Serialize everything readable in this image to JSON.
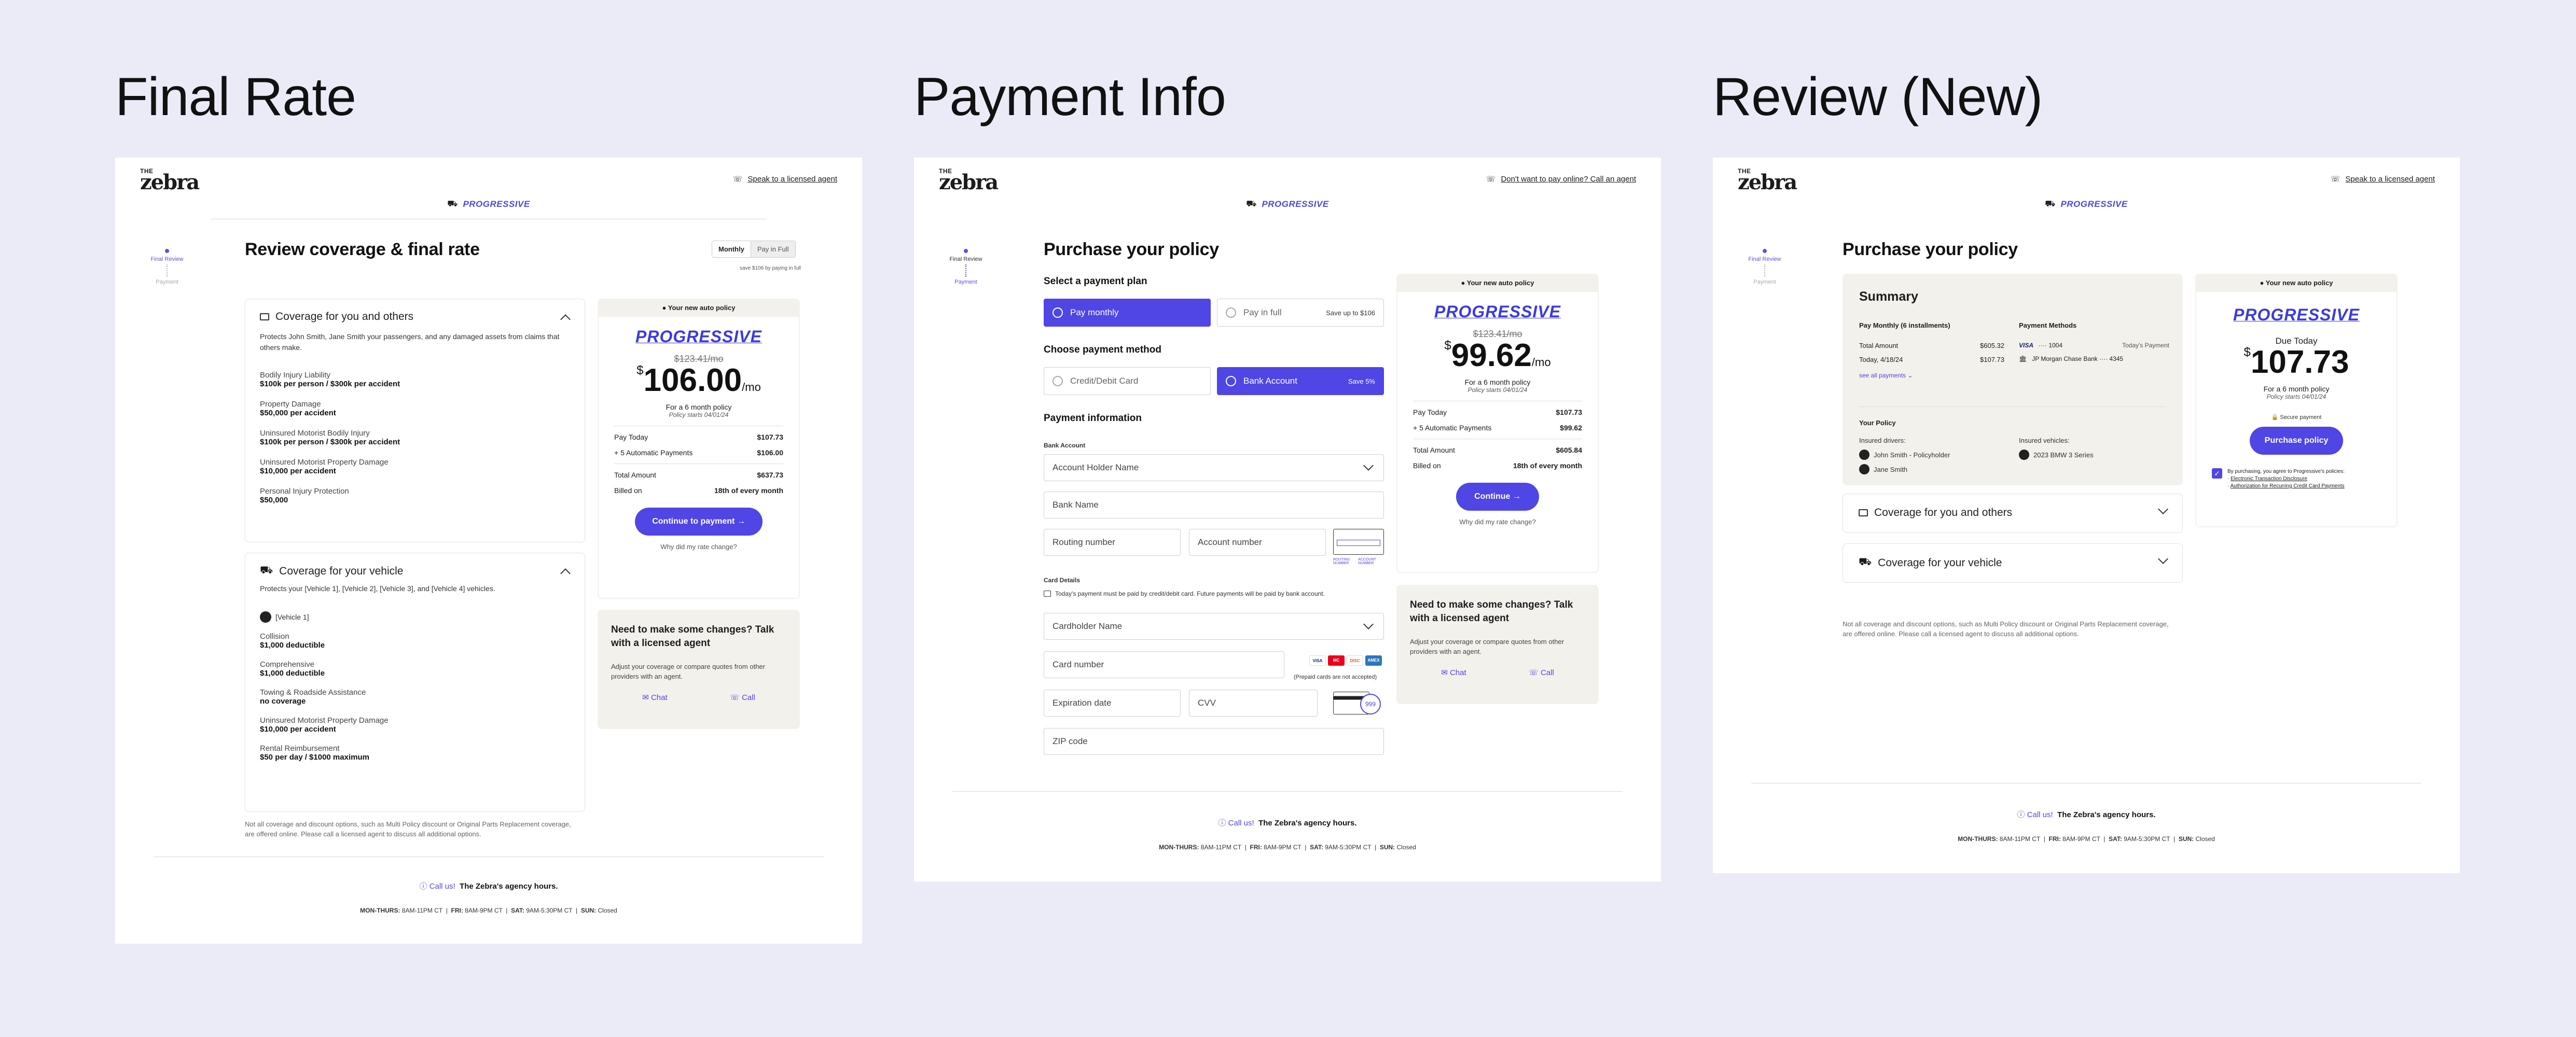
{
  "colors": {
    "accent": "#4f46e5",
    "background": "#ebebf8",
    "beige": "#f3f1ec"
  },
  "sections": {
    "s1": "Final Rate",
    "s2": "Payment Info",
    "s3": "Review (New)"
  },
  "common": {
    "logo_the": "THE",
    "logo_zebra": "zebra",
    "brand": "PROGRESSIVE",
    "your_new_policy": "Your new auto policy",
    "step1": "Final Review",
    "step2": "Payment",
    "call_us": "Call us!",
    "agency_hours": "The Zebra's agency hours.",
    "hours": {
      "mt_l": "MON-THURS:",
      "mt_v": "8AM-11PM CT",
      "fri_l": "FRI:",
      "fri_v": "8AM-9PM CT",
      "sat_l": "SAT:",
      "sat_v": "9AM-5:30PM CT",
      "sun_l": "SUN:",
      "sun_v": "Closed"
    },
    "chat": "Chat",
    "call": "Call",
    "changes_title": "Need to make some changes? Talk with a licensed agent",
    "changes_body": "Adjust your coverage or compare quotes from other providers with an agent.",
    "disclaimer": "Not all coverage and discount options, such as Multi Policy discount or Original Parts Replacement coverage, are offered online. Please call a licensed agent to discuss all additional options."
  },
  "final_rate": {
    "agent_link": "Speak to a licensed agent",
    "title": "Review coverage & final rate",
    "toggle_monthly": "Monthly",
    "toggle_full": "Pay in Full",
    "save_note": "save $106 by paying in full",
    "cov_others_title": "Coverage for you and others",
    "cov_others_desc": "Protects John Smith, Jane Smith your passengers, and any damaged assets from claims that others make.",
    "others_items": [
      {
        "label": "Bodily Injury Liability",
        "value": "$100k per person / $300k per accident"
      },
      {
        "label": "Property Damage",
        "value": "$50,000 per accident"
      },
      {
        "label": "Uninsured Motorist Bodily Injury",
        "value": "$100k per person / $300k per accident"
      },
      {
        "label": "Uninsured Motorist Property Damage",
        "value": "$10,000 per accident"
      },
      {
        "label": "Personal Injury Protection",
        "value": "$50,000"
      }
    ],
    "cov_vehicle_title": "Coverage for your vehicle",
    "cov_vehicle_desc": "Protects your [Vehicle 1], [Vehicle 2], [Vehicle 3], and [Vehicle 4] vehicles.",
    "vehicle_name": "[Vehicle 1]",
    "vehicle_items": [
      {
        "label": "Collision",
        "value": "$1,000 deductible"
      },
      {
        "label": "Comprehensive",
        "value": "$1,000 deductible"
      },
      {
        "label": "Towing & Roadside Assistance",
        "value": "no coverage"
      },
      {
        "label": "Uninsured Motorist Property Damage",
        "value": "$10,000 per accident"
      },
      {
        "label": "Rental Reimbursement",
        "value": "$50 per day / $1000 maximum"
      }
    ],
    "old_price": "$123.41/mo",
    "price_sym": "$",
    "price": "106.00",
    "per": "/mo",
    "term": "For a 6 month policy",
    "starts": "Policy starts 04/01/24",
    "pay_today_l": "Pay Today",
    "pay_today_v": "$107.73",
    "auto_l": "+ 5 Automatic Payments",
    "auto_v": "$106.00",
    "total_l": "Total Amount",
    "total_v": "$637.73",
    "billed_l": "Billed on",
    "billed_v": "18th of every month",
    "continue": "Continue to payment",
    "why": "Why did my rate change?"
  },
  "payment": {
    "agent_link": "Don't want to pay online? Call an agent",
    "title": "Purchase your policy",
    "plan_h": "Select a payment plan",
    "plan_monthly": "Pay monthly",
    "plan_full": "Pay in full",
    "plan_save": "Save up to $106",
    "method_h": "Choose payment method",
    "method_card": "Credit/Debit Card",
    "method_bank": "Bank Account",
    "method_save": "Save 5%",
    "info_h": "Payment information",
    "bank_l": "Bank Account",
    "holder": "Account Holder Name",
    "bank_name": "Bank Name",
    "routing": "Routing number",
    "account": "Account number",
    "check_routing": "ROUTING NUMBER",
    "check_account": "ACCOUNT NUMBER",
    "card_l": "Card Details",
    "card_note": "Today's payment must be paid by credit/debit card. Future payments will be paid by bank account.",
    "cardholder": "Cardholder Name",
    "card_number": "Card number",
    "prepaid": "(Prepaid cards are not accepted)",
    "exp": "Expiration date",
    "cvv": "CVV",
    "cvv_badge": "999",
    "zip": "ZIP code",
    "brands": [
      "VISA",
      "MC",
      "DISC",
      "AMEX"
    ],
    "old_price": "$123.41/mo",
    "price_sym": "$",
    "price": "99.62",
    "per": "/mo",
    "term": "For a 6 month policy",
    "starts": "Policy starts 04/01/24",
    "pay_today_l": "Pay Today",
    "pay_today_v": "$107.73",
    "auto_l": "+ 5 Automatic Payments",
    "auto_v": "$99.62",
    "total_l": "Total Amount",
    "total_v": "$605.84",
    "billed_l": "Billed on",
    "billed_v": "18th of every month",
    "continue": "Continue",
    "why": "Why did my rate change?"
  },
  "review": {
    "agent_link": "Speak to a licensed agent",
    "title": "Purchase your policy",
    "summary": "Summary",
    "pm_h": "Pay Monthly (6 installments)",
    "total_l": "Total Amount",
    "total_v": "$605.32",
    "today_l": "Today, 4/18/24",
    "today_v": "$107.73",
    "see_all": "see all payments",
    "methods_h": "Payment Methods",
    "visa": "VISA",
    "visa_num": "···· 1004",
    "todays": "Today's Payment",
    "bank": "JP Morgan Chase Bank ···· 4345",
    "policy_h": "Your Policy",
    "drivers_h": "Insured drivers:",
    "driver1": "John Smith - Policyholder",
    "driver2": "Jane Smith",
    "vehicles_h": "Insured vehicles:",
    "vehicle1": "2023 BMW 3 Series",
    "cov_others": "Coverage for you and others",
    "cov_vehicle": "Coverage for your vehicle",
    "due": "Due Today",
    "price_sym": "$",
    "price": "107.73",
    "term": "For a 6 month policy",
    "starts": "Policy starts 04/01/24",
    "secure": "Secure payment",
    "purchase": "Purchase policy",
    "agree": "By purchasing, you agree to Progressive's policies:",
    "agree1": "Electronic Transaction Disclosure",
    "agree2": "Authorization for Recurring Credit Card Payments"
  }
}
